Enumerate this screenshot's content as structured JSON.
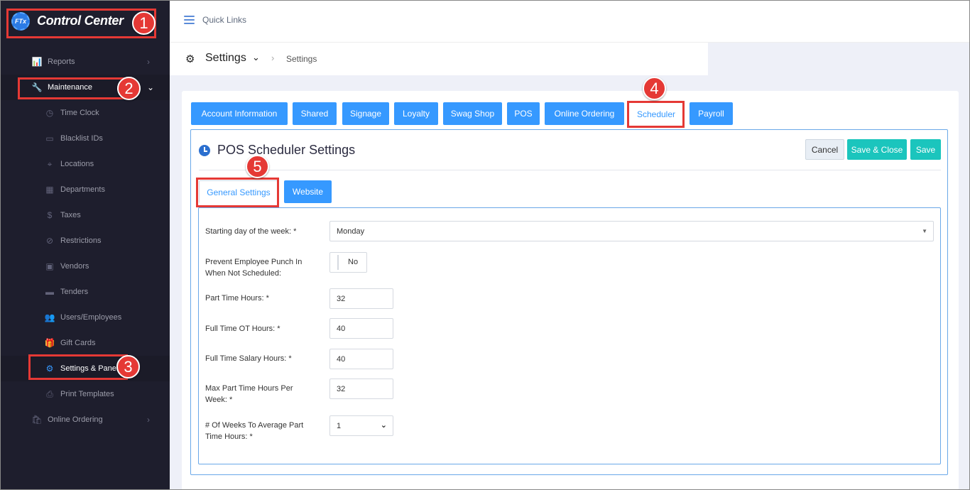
{
  "brand": {
    "logo_text": "FTx",
    "title": "Control Center"
  },
  "sidebar": {
    "reports": "Reports",
    "maintenance": "Maintenance",
    "items": [
      {
        "label": "Time Clock"
      },
      {
        "label": "Blacklist IDs"
      },
      {
        "label": "Locations"
      },
      {
        "label": "Departments"
      },
      {
        "label": "Taxes"
      },
      {
        "label": "Restrictions"
      },
      {
        "label": "Vendors"
      },
      {
        "label": "Tenders"
      },
      {
        "label": "Users/Employees"
      },
      {
        "label": "Gift Cards"
      },
      {
        "label": "Settings & Panels"
      },
      {
        "label": "Print Templates"
      }
    ],
    "online_ordering": "Online Ordering"
  },
  "topbar": {
    "quick_links": "Quick Links"
  },
  "subheader": {
    "title": "Settings",
    "crumb": "Settings"
  },
  "tabs": [
    "Account Information",
    "Shared",
    "Signage",
    "Loyalty",
    "Swag Shop",
    "POS",
    "Online Ordering",
    "Scheduler",
    "Payroll"
  ],
  "panel": {
    "title": "POS Scheduler Settings",
    "cancel": "Cancel",
    "save_close": "Save & Close",
    "save": "Save"
  },
  "subtabs": {
    "general": "General Settings",
    "website": "Website"
  },
  "form": {
    "start_day_label": "Starting day of the week: *",
    "start_day_value": "Monday",
    "prevent_label": "Prevent Employee Punch In When Not Scheduled:",
    "prevent_value": "No",
    "part_time_label": "Part Time Hours: *",
    "part_time_value": "32",
    "ft_ot_label": "Full Time OT Hours: *",
    "ft_ot_value": "40",
    "ft_salary_label": "Full Time Salary Hours: *",
    "ft_salary_value": "40",
    "max_pt_label": "Max Part Time Hours Per Week: *",
    "max_pt_value": "32",
    "weeks_avg_label": "# Of Weeks To Average Part Time Hours: *",
    "weeks_avg_value": "1"
  },
  "markers": [
    "1",
    "2",
    "3",
    "4",
    "5"
  ],
  "colors": {
    "accent": "#3699ff",
    "teal": "#1bc5bd",
    "marker": "#e53935",
    "sidebar": "#1e1e2d"
  }
}
